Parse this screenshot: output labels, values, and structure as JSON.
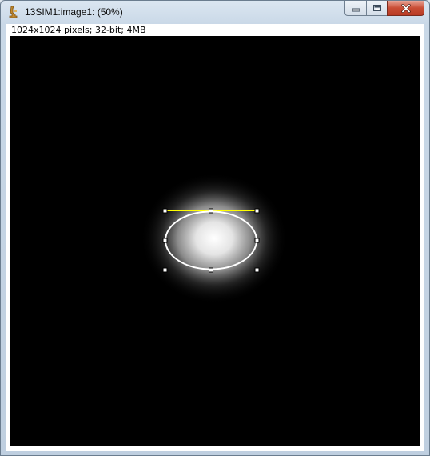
{
  "window": {
    "title": "13SIM1:image1: (50%)",
    "icon": "imagej-microscope-icon",
    "buttons": {
      "minimize": "minimize-icon",
      "maximize": "maximize-icon",
      "close": "close-icon"
    }
  },
  "image": {
    "info": "1024x1024 pixels; 32-bit; 4MB",
    "zoom_percent": 50,
    "background_color": "#000000"
  },
  "roi": {
    "shape": "ellipse",
    "outline_color": "#ffffff",
    "bounding_box_color": "#ffff00",
    "handle_color": "#ffffff",
    "handle_count": 8
  },
  "colors": {
    "titlebar": "#c9d8e7",
    "close_button": "#c94d35"
  }
}
